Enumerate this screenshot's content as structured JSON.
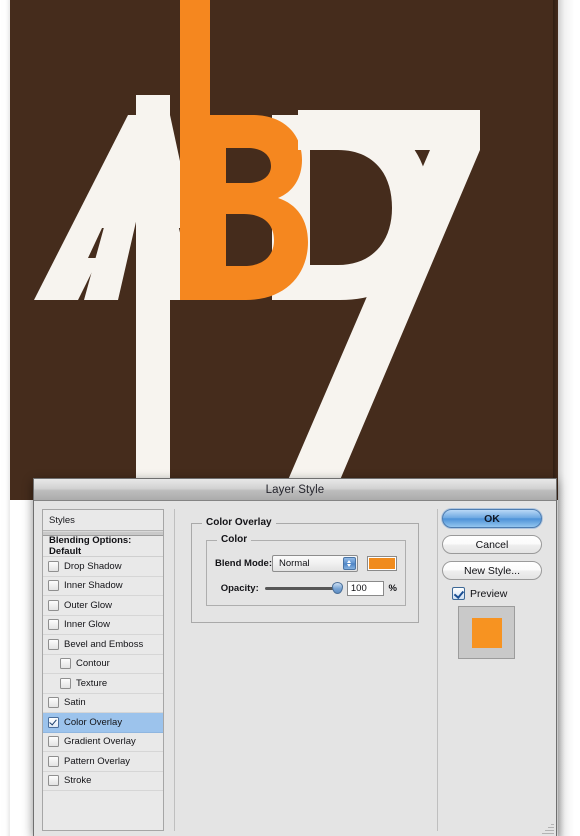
{
  "artwork": {
    "alt_text": "Brown poster with white letters A B D and large white numeral 17, letter B filled orange",
    "background_color": "#452c1c",
    "letters_color": "#f7f4ef",
    "accent_color": "#f5871f",
    "letters": "ABD",
    "numeral": "17"
  },
  "dialog": {
    "title": "Layer Style",
    "styles_panel": {
      "header_label": "Styles",
      "blending_options_label": "Blending Options: Default",
      "items": [
        {
          "label": "Drop Shadow",
          "checked": false,
          "indent": false
        },
        {
          "label": "Inner Shadow",
          "checked": false,
          "indent": false
        },
        {
          "label": "Outer Glow",
          "checked": false,
          "indent": false
        },
        {
          "label": "Inner Glow",
          "checked": false,
          "indent": false
        },
        {
          "label": "Bevel and Emboss",
          "checked": false,
          "indent": false
        },
        {
          "label": "Contour",
          "checked": false,
          "indent": true
        },
        {
          "label": "Texture",
          "checked": false,
          "indent": true
        },
        {
          "label": "Satin",
          "checked": false,
          "indent": false
        },
        {
          "label": "Color Overlay",
          "checked": true,
          "indent": false,
          "selected": true
        },
        {
          "label": "Gradient Overlay",
          "checked": false,
          "indent": false
        },
        {
          "label": "Pattern Overlay",
          "checked": false,
          "indent": false
        },
        {
          "label": "Stroke",
          "checked": false,
          "indent": false
        }
      ],
      "selected_item": "Color Overlay",
      "selection_color": "#9cc3ec"
    },
    "center_panel": {
      "group_title": "Color Overlay",
      "subgroup_title": "Color",
      "blend_mode_label": "Blend Mode:",
      "blend_mode_value": "Normal",
      "overlay_color": "#f08b1d",
      "opacity_label": "Opacity:",
      "opacity_value": "100",
      "opacity_unit": "%",
      "opacity_percent": 100
    },
    "buttons": {
      "ok_label": "OK",
      "cancel_label": "Cancel",
      "new_style_label": "New Style...",
      "preview_label": "Preview",
      "preview_checked": true,
      "preview_swatch_color": "#f79321"
    }
  }
}
